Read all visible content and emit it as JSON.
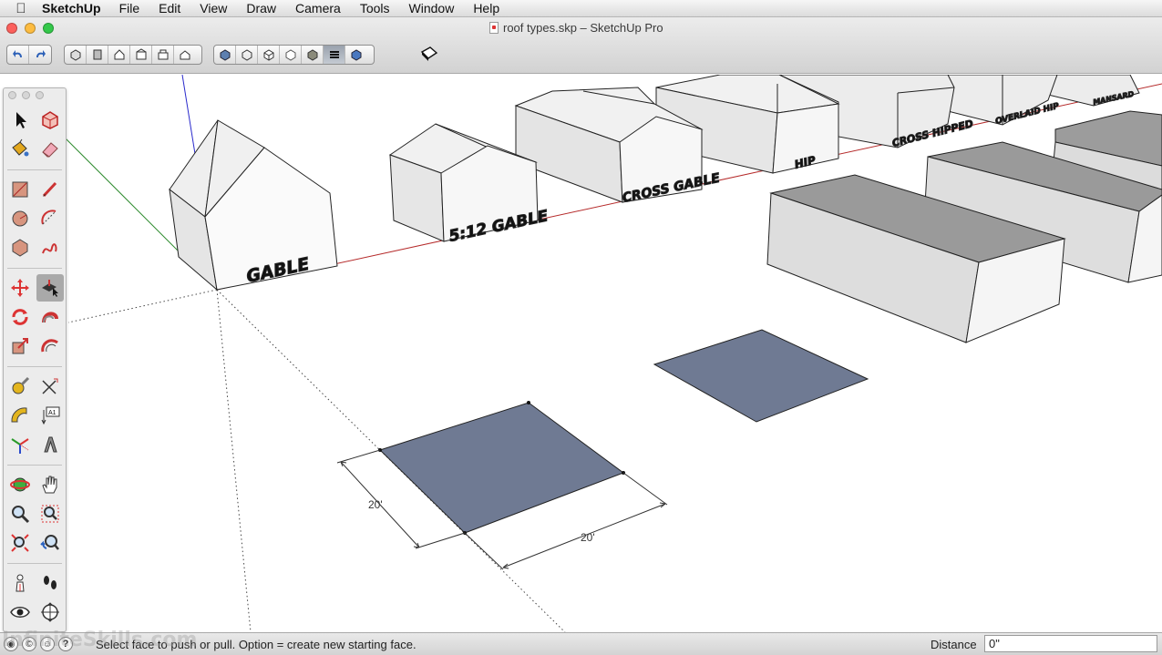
{
  "menubar": {
    "app_name": "SketchUp",
    "items": [
      "File",
      "Edit",
      "View",
      "Draw",
      "Camera",
      "Tools",
      "Window",
      "Help"
    ]
  },
  "window": {
    "title": "roof types.skp – SketchUp Pro"
  },
  "toolbar": {
    "undo_redo": [
      "undo-icon",
      "redo-icon"
    ],
    "views": [
      "iso-view-icon",
      "top-view-icon",
      "front-view-icon",
      "right-view-icon",
      "back-view-icon",
      "left-view-icon"
    ],
    "styles": [
      "xray-icon",
      "wireframe-icon",
      "hidden-line-icon",
      "shaded-icon",
      "shaded-textures-icon",
      "monochrome-icon",
      "back-edges-icon"
    ],
    "active_style_index": 5
  },
  "scene": {
    "building_labels": {
      "gable": "GABLE",
      "gable_512": "5:12 GABLE",
      "cross_gable": "CROSS GABLE",
      "hip": "HIP",
      "cross_hipped": "CROSS HIPPED",
      "overlaid_hip": "OVERLAID HIP",
      "mansard": "MANSARD"
    },
    "dimension_a": "20'",
    "dimension_b": "20'",
    "face_color": "#6f7a93",
    "axis_colors": {
      "red": "#b52a2a",
      "green": "#2e8b2e",
      "blue": "#2a2acc"
    }
  },
  "palette": {
    "tools": [
      "select-icon",
      "make-component-icon",
      "paint-bucket-icon",
      "eraser-icon",
      "rectangle-icon",
      "line-icon",
      "circle-icon",
      "arc-icon",
      "polygon-icon",
      "freehand-icon",
      "move-icon",
      "push-pull-icon",
      "rotate-icon",
      "follow-me-icon",
      "scale-icon",
      "offset-icon",
      "tape-measure-icon",
      "dimension-icon",
      "protractor-icon",
      "text-icon",
      "axes-icon",
      "3d-text-icon",
      "orbit-icon",
      "pan-icon",
      "zoom-icon",
      "zoom-window-icon",
      "zoom-extents-icon",
      "previous-view-icon",
      "position-camera-icon",
      "walk-icon",
      "look-around-icon",
      "section-plane-icon"
    ],
    "active_tool": "push-pull-icon"
  },
  "statusbar": {
    "help_icon": "?",
    "message": "Select face to push or pull.  Option = create new starting face.",
    "measurement_label": "Distance",
    "measurement_value": "0\""
  },
  "watermark": "InfiniteSkills.com"
}
